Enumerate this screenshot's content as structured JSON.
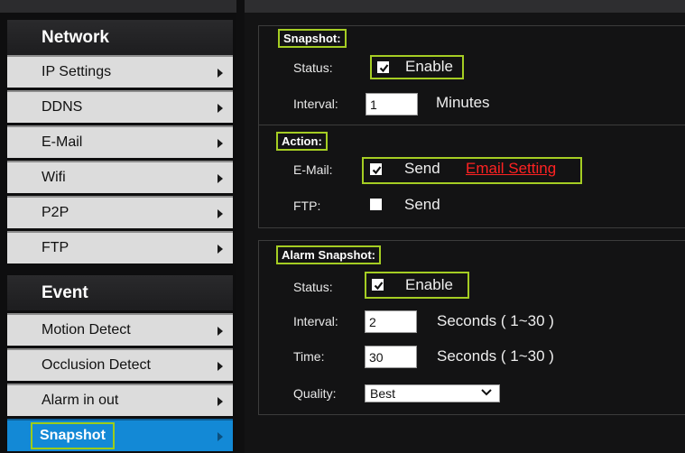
{
  "sidebar": {
    "network_header": "Network",
    "network_items": [
      {
        "label": "IP Settings"
      },
      {
        "label": "DDNS"
      },
      {
        "label": "E-Mail"
      },
      {
        "label": "Wifi"
      },
      {
        "label": "P2P"
      },
      {
        "label": "FTP"
      }
    ],
    "event_header": "Event",
    "event_items": [
      {
        "label": "Motion Detect"
      },
      {
        "label": "Occlusion Detect"
      },
      {
        "label": "Alarm in out"
      },
      {
        "label": "Snapshot",
        "active": true
      }
    ]
  },
  "snapshot": {
    "title": "Snapshot:",
    "status_label": "Status:",
    "status_checked": true,
    "status_text": "Enable",
    "interval_label": "Interval:",
    "interval_value": "1",
    "interval_unit": "Minutes"
  },
  "action": {
    "title": "Action:",
    "email_label": "E-Mail:",
    "email_checked": true,
    "email_text": "Send",
    "email_setting_link": "Email Setting",
    "ftp_label": "FTP:",
    "ftp_checked": false,
    "ftp_text": "Send"
  },
  "alarm_snapshot": {
    "title": "Alarm Snapshot:",
    "status_label": "Status:",
    "status_checked": true,
    "status_text": "Enable",
    "interval_label": "Interval:",
    "interval_value": "2",
    "interval_unit": "Seconds ( 1~30 )",
    "time_label": "Time:",
    "time_value": "30",
    "time_unit": "Seconds ( 1~30 )",
    "quality_label": "Quality:",
    "quality_value": "Best"
  },
  "colors": {
    "accent_highlight": "#a5cd23",
    "active_tab": "#1389d6",
    "link": "#ff2222"
  }
}
